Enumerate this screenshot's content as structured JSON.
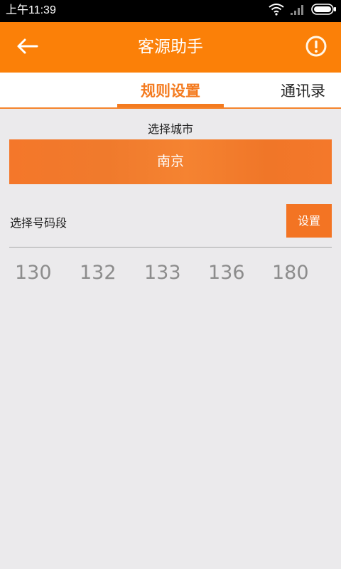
{
  "status_bar": {
    "time": "上午11:39",
    "icons": [
      "wifi-icon",
      "signal-icon",
      "battery-icon"
    ]
  },
  "header": {
    "title": "客源助手",
    "back_icon": "arrow-left-icon",
    "info_icon": "exclamation-circle-icon",
    "color": "#fb8008"
  },
  "tabs": [
    {
      "label": "规则设置",
      "active": true
    },
    {
      "label": "通讯录",
      "active": false
    }
  ],
  "city": {
    "caption": "选择城市",
    "selected": "南京"
  },
  "segments": {
    "caption": "选择号码段",
    "set_button": "设置",
    "values": [
      "130",
      "132",
      "133",
      "136",
      "180"
    ]
  },
  "accent": "#f47b20"
}
